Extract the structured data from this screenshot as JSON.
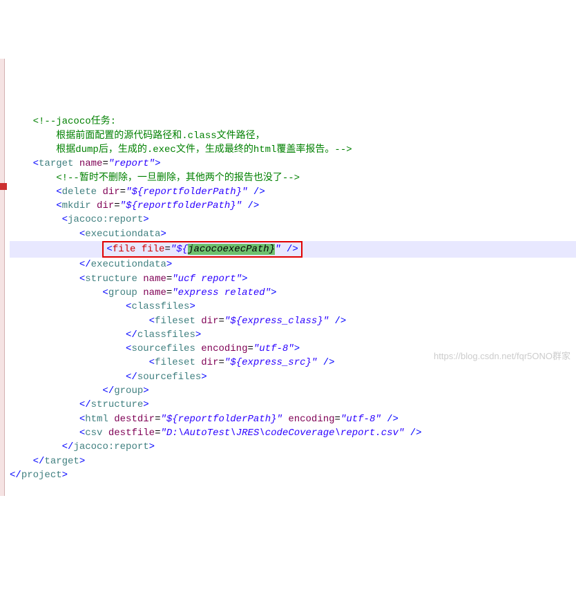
{
  "c1": "<!--jacoco任务:",
  "c2": "    根据前面配置的源代码路径和.class文件路径，",
  "c3": "    根据dump后，生成的.exec文件，生成最终的html覆盖率报告。-->",
  "target": {
    "tag": "target",
    "attr": "name",
    "eq": "=",
    "val": "\"report\""
  },
  "c4": "<!--暂时不删除，一旦删除，其他两个的报告也没了-->",
  "delete": {
    "tag": "delete",
    "attr": "dir",
    "eq": "=",
    "val": "\"${reportfolderPath}\"",
    "close": " />"
  },
  "mkdir": {
    "tag": "mkdir",
    "attr": "dir",
    "eq": "=",
    "val": "\"${reportfolderPath}\"",
    "close": " />"
  },
  "jacoco_open": "jacoco:report",
  "exec_open": "executiondata",
  "file": {
    "tag": "file",
    "attr": "file",
    "eq": "=",
    "v1": "\"${",
    "v2": "jacocoexecPath}",
    "v3": "\"",
    "close": " />"
  },
  "exec_close": "executiondata",
  "structure": {
    "tag": "structure",
    "attr": "name",
    "eq": "=",
    "val": "\"ucf report\""
  },
  "group": {
    "tag": "group",
    "attr": "name",
    "eq": "=",
    "val": "\"express related\""
  },
  "classfiles": "classfiles",
  "fileset1": {
    "tag": "fileset",
    "attr": "dir",
    "eq": "=",
    "val": "\"${express_class}\"",
    "close": " />"
  },
  "sourcefiles": {
    "tag": "sourcefiles",
    "attr": "encoding",
    "eq": "=",
    "val": "\"utf-8\""
  },
  "fileset2": {
    "tag": "fileset",
    "attr": "dir",
    "eq": "=",
    "val": "\"${express_src}\"",
    "close": " />"
  },
  "html": {
    "tag": "html",
    "a1n": "destdir",
    "a1v": "\"${reportfolderPath}\"",
    "a2n": "encoding",
    "a2v": "\"utf-8\"",
    "close": " />"
  },
  "csv": {
    "tag": "csv",
    "attr": "destfile",
    "eq": "=",
    "val": "\"D:\\AutoTest\\JRES\\codeCoverage\\report.csv\"",
    "close": " />"
  },
  "jacoco_close": "jacoco:report",
  "target_close": "target",
  "project_close": "project",
  "watermark": "https://blog.csdn.net/fqr5ONO群家"
}
